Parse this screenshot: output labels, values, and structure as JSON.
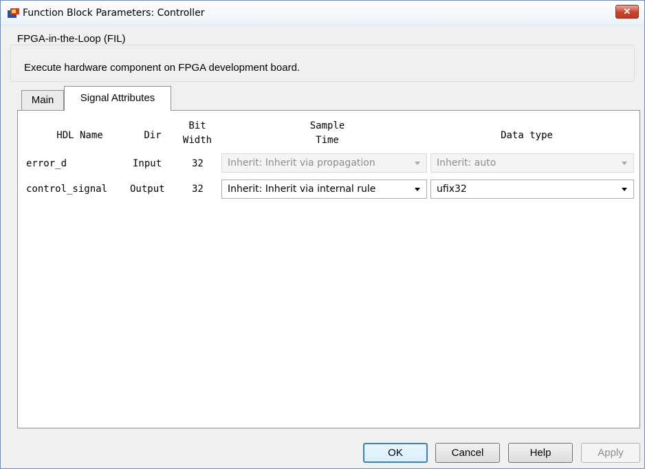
{
  "window": {
    "title": "Function Block Parameters: Controller",
    "close_glyph": "✕"
  },
  "block": {
    "group_label": "FPGA-in-the-Loop (FIL)",
    "description": "Execute hardware component on FPGA development board."
  },
  "tabs": [
    {
      "label": "Main",
      "active": false
    },
    {
      "label": "Signal Attributes",
      "active": true
    }
  ],
  "table": {
    "headers": {
      "hdl_name": "HDL Name",
      "dir": "Dir",
      "bit_width_1": "Bit",
      "bit_width_2": "Width",
      "sample_time_1": "Sample",
      "sample_time_2": "Time",
      "data_type": "Data type"
    },
    "rows": [
      {
        "hdl_name": "error_d",
        "dir": "Input",
        "bit_width": "32",
        "sample_time": "Inherit: Inherit via propagation",
        "sample_time_enabled": false,
        "data_type": "Inherit: auto",
        "data_type_enabled": false
      },
      {
        "hdl_name": "control_signal",
        "dir": "Output",
        "bit_width": "32",
        "sample_time": "Inherit: Inherit via internal rule",
        "sample_time_enabled": true,
        "data_type": "ufix32",
        "data_type_enabled": true
      }
    ]
  },
  "buttons": {
    "ok": "OK",
    "cancel": "Cancel",
    "help": "Help",
    "apply": "Apply"
  },
  "icons": {
    "app_icon": "simulink-block-icon",
    "close": "close-icon",
    "dropdown": "chevron-down-icon"
  }
}
